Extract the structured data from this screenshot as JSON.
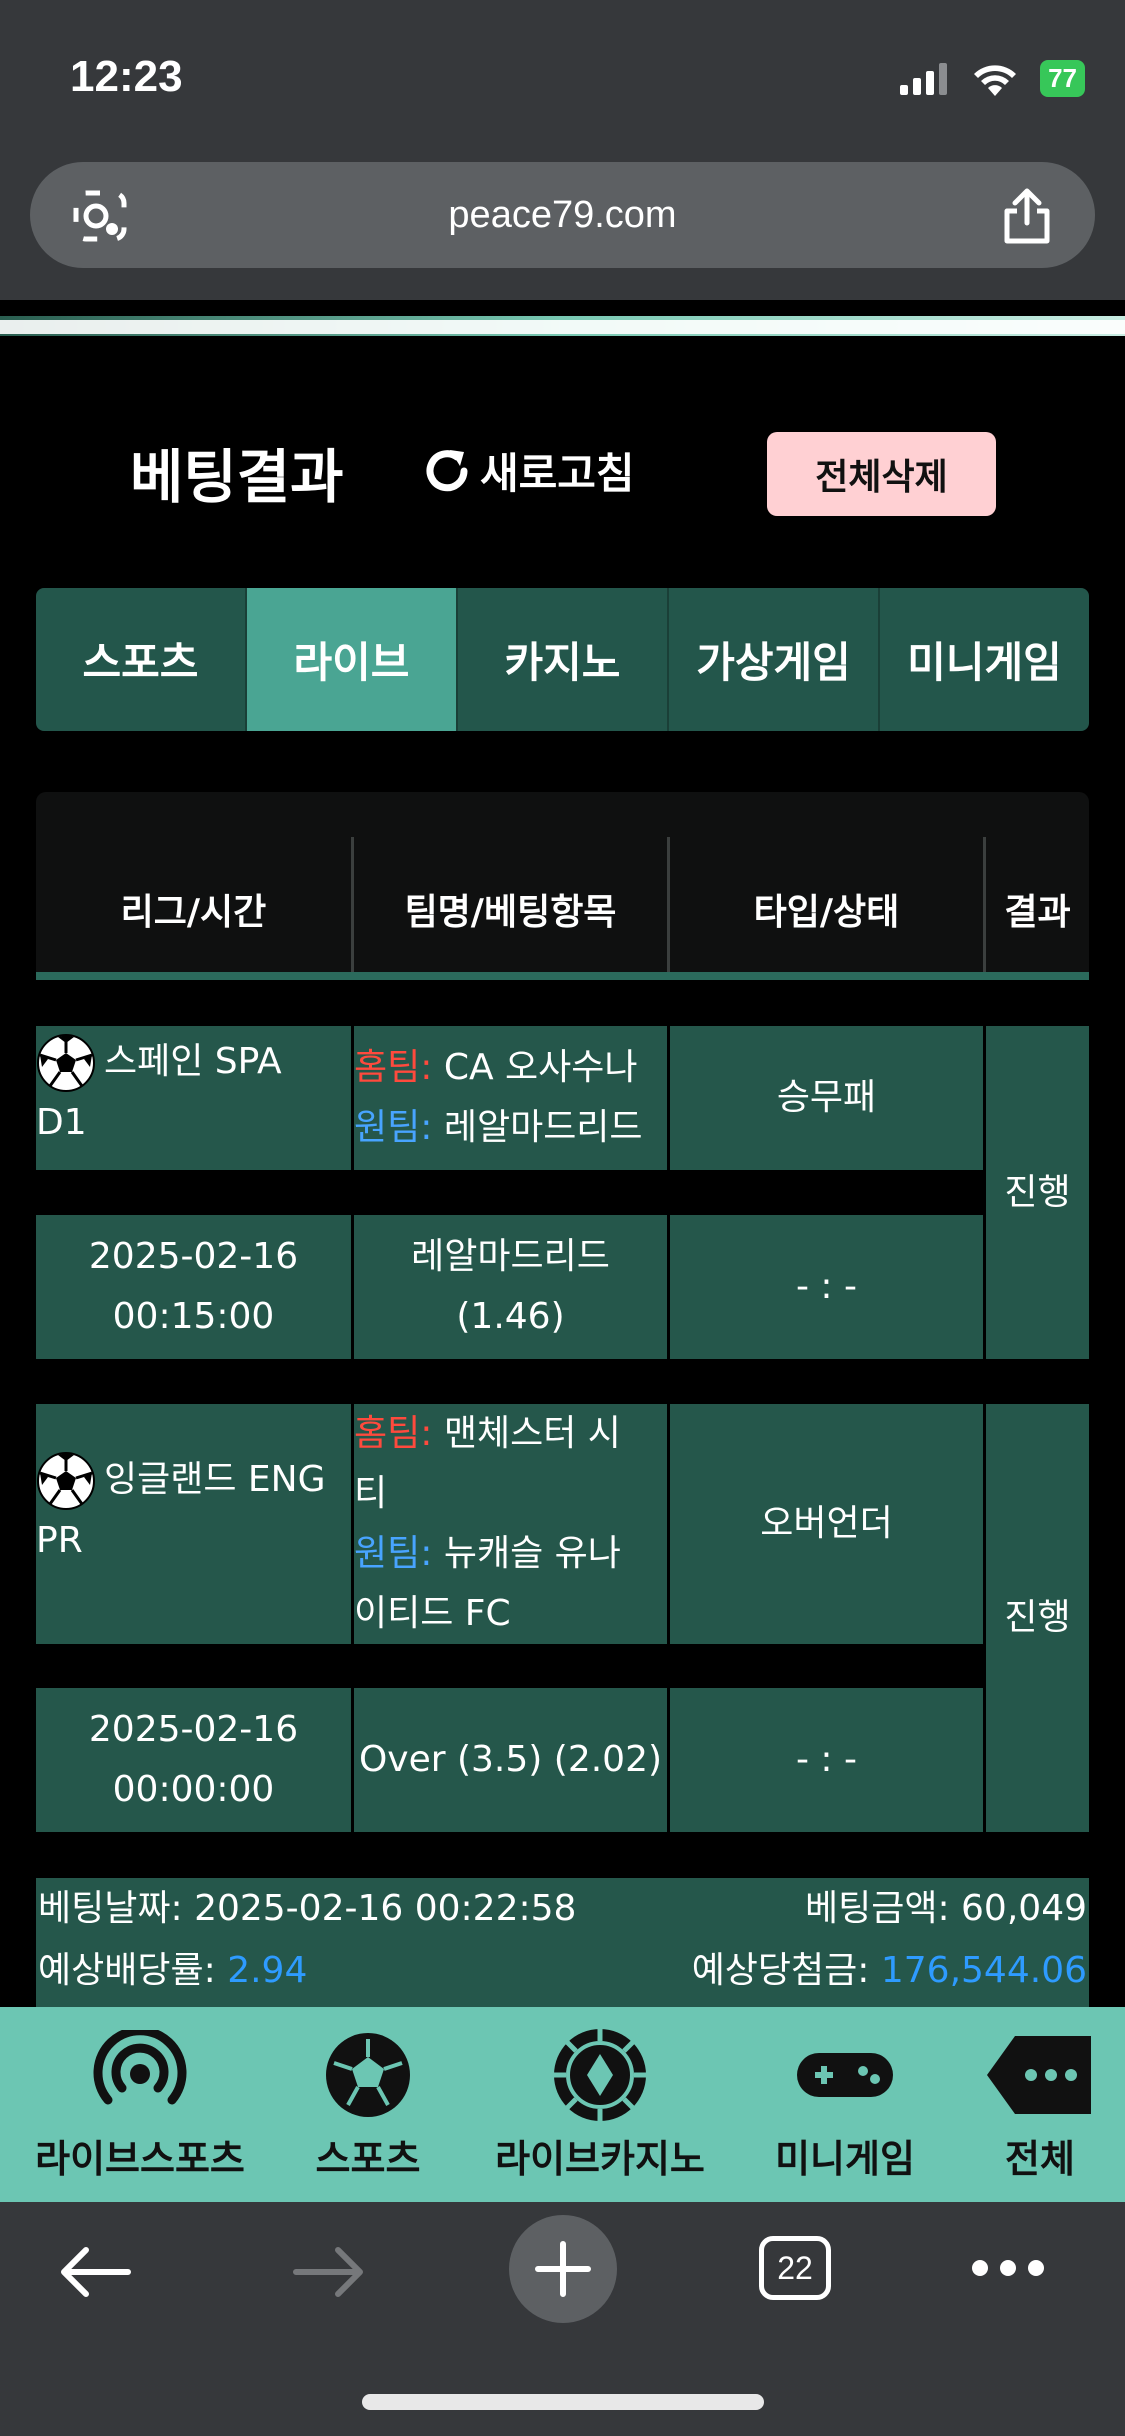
{
  "status": {
    "time": "12:23",
    "battery": "77"
  },
  "browser": {
    "url": "peace79.com",
    "tab_count": "22"
  },
  "header": {
    "title": "베팅결과",
    "refresh_label": "새로고침",
    "delete_all_label": "전체삭제"
  },
  "tabs": [
    {
      "label": "스포츠",
      "active": false
    },
    {
      "label": "라이브",
      "active": true
    },
    {
      "label": "카지노",
      "active": false
    },
    {
      "label": "가상게임",
      "active": false
    },
    {
      "label": "미니게임",
      "active": false
    }
  ],
  "table": {
    "headers": [
      "리그/시간",
      "팀명/베팅항목",
      "타입/상태",
      "결과"
    ],
    "home_label": "홈팀:",
    "away_label": "원팀:",
    "bets": [
      {
        "league_line1": "스페인 SPA",
        "league_line2": "D1",
        "home_team": "CA 오사수나",
        "away_team": "레알마드리드",
        "type": "승무패",
        "date": "2025-02-16",
        "time": "00:15:00",
        "pick_line1": "레알마드리드",
        "pick_line2": "(1.46)",
        "score": "- : -",
        "result": "진행"
      },
      {
        "league_line1": "잉글랜드 ENG",
        "league_line2": "PR",
        "home_team_line1": "맨체스터 시",
        "home_team_line2": "티",
        "away_team_line1": "뉴캐슬 유나",
        "away_team_line2": "이티드 FC",
        "type": "오버언더",
        "date": "2025-02-16",
        "time": "00:00:00",
        "pick_line1": "Over (3.5) (2.02)",
        "score": "- : -",
        "result": "진행"
      }
    ]
  },
  "summary": {
    "bet_date_label": "베팅날짜:",
    "bet_date_value": "2025-02-16 00:22:58",
    "bet_amount_label": "베팅금액:",
    "bet_amount_value": "60,049",
    "odds_label": "예상배당률:",
    "odds_value": "2.94",
    "payout_label": "예상당첨금:",
    "payout_value": "176,544.06"
  },
  "bottom_nav": [
    {
      "label": "라이브스포츠",
      "icon": "live-broadcast-icon"
    },
    {
      "label": "스포츠",
      "icon": "soccer-ball-icon"
    },
    {
      "label": "라이브카지노",
      "icon": "casino-chip-icon"
    },
    {
      "label": "미니게임",
      "icon": "gamepad-icon"
    },
    {
      "label": "전체",
      "icon": "more-tag-icon"
    }
  ],
  "colors": {
    "cell": "#25574b",
    "tab_active": "#4aa593",
    "nav": "#6cc6b3",
    "home": "#ff4a3d",
    "away": "#48a4ff",
    "delete_btn": "#ffd0d3"
  }
}
